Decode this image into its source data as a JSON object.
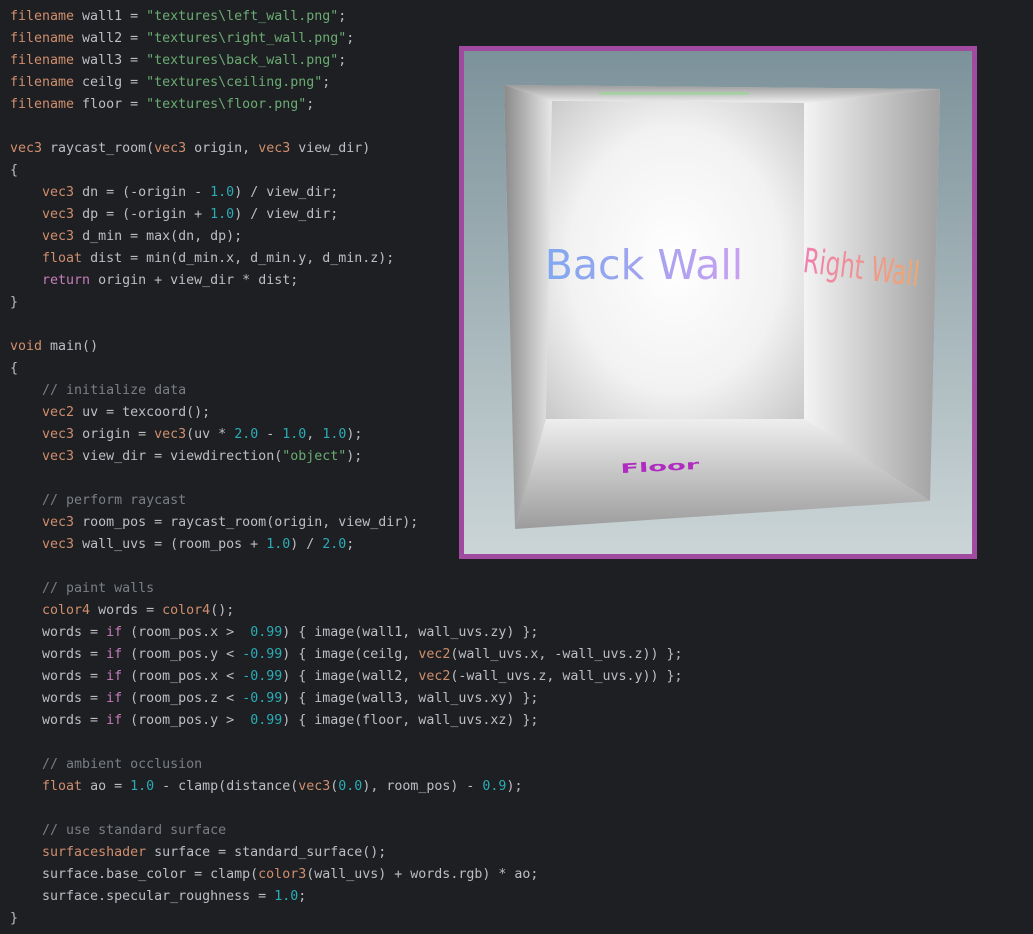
{
  "editor": {
    "lines": [
      [
        {
          "t": "filename",
          "c": "kw"
        },
        {
          "t": " wall1 = ",
          "c": "plain"
        },
        {
          "t": "\"textures\\left_wall.png\"",
          "c": "str"
        },
        {
          "t": ";",
          "c": "plain"
        }
      ],
      [
        {
          "t": "filename",
          "c": "kw"
        },
        {
          "t": " wall2 = ",
          "c": "plain"
        },
        {
          "t": "\"textures\\right_wall.png\"",
          "c": "str"
        },
        {
          "t": ";",
          "c": "plain"
        }
      ],
      [
        {
          "t": "filename",
          "c": "kw"
        },
        {
          "t": " wall3 = ",
          "c": "plain"
        },
        {
          "t": "\"textures\\back_wall.png\"",
          "c": "str"
        },
        {
          "t": ";",
          "c": "plain"
        }
      ],
      [
        {
          "t": "filename",
          "c": "kw"
        },
        {
          "t": " ceilg = ",
          "c": "plain"
        },
        {
          "t": "\"textures\\ceiling.png\"",
          "c": "str"
        },
        {
          "t": ";",
          "c": "plain"
        }
      ],
      [
        {
          "t": "filename",
          "c": "kw"
        },
        {
          "t": " floor = ",
          "c": "plain"
        },
        {
          "t": "\"textures\\floor.png\"",
          "c": "str"
        },
        {
          "t": ";",
          "c": "plain"
        }
      ],
      [],
      [
        {
          "t": "vec3",
          "c": "kw"
        },
        {
          "t": " raycast_room(",
          "c": "plain"
        },
        {
          "t": "vec3",
          "c": "kw"
        },
        {
          "t": " origin, ",
          "c": "plain"
        },
        {
          "t": "vec3",
          "c": "kw"
        },
        {
          "t": " view_dir)",
          "c": "plain"
        }
      ],
      [
        {
          "t": "{",
          "c": "plain"
        }
      ],
      [
        {
          "t": "    ",
          "c": "plain"
        },
        {
          "t": "vec3",
          "c": "kw"
        },
        {
          "t": " dn = (-origin - ",
          "c": "plain"
        },
        {
          "t": "1.0",
          "c": "num"
        },
        {
          "t": ") / view_dir;",
          "c": "plain"
        }
      ],
      [
        {
          "t": "    ",
          "c": "plain"
        },
        {
          "t": "vec3",
          "c": "kw"
        },
        {
          "t": " dp = (-origin + ",
          "c": "plain"
        },
        {
          "t": "1.0",
          "c": "num"
        },
        {
          "t": ") / view_dir;",
          "c": "plain"
        }
      ],
      [
        {
          "t": "    ",
          "c": "plain"
        },
        {
          "t": "vec3",
          "c": "kw"
        },
        {
          "t": " d_min = max(dn, dp);",
          "c": "plain"
        }
      ],
      [
        {
          "t": "    ",
          "c": "plain"
        },
        {
          "t": "float",
          "c": "kw"
        },
        {
          "t": " dist = min(d_min.x, d_min.y, d_min.z);",
          "c": "plain"
        }
      ],
      [
        {
          "t": "    ",
          "c": "plain"
        },
        {
          "t": "return",
          "c": "ctrl"
        },
        {
          "t": " origin + view_dir * dist;",
          "c": "plain"
        }
      ],
      [
        {
          "t": "}",
          "c": "plain"
        }
      ],
      [],
      [
        {
          "t": "void",
          "c": "kw"
        },
        {
          "t": " main()",
          "c": "plain"
        }
      ],
      [
        {
          "t": "{",
          "c": "plain"
        }
      ],
      [
        {
          "t": "    ",
          "c": "plain"
        },
        {
          "t": "// initialize data",
          "c": "cmt"
        }
      ],
      [
        {
          "t": "    ",
          "c": "plain"
        },
        {
          "t": "vec2",
          "c": "kw"
        },
        {
          "t": " uv = texcoord();",
          "c": "plain"
        }
      ],
      [
        {
          "t": "    ",
          "c": "plain"
        },
        {
          "t": "vec3",
          "c": "kw"
        },
        {
          "t": " origin = ",
          "c": "plain"
        },
        {
          "t": "vec3",
          "c": "kw"
        },
        {
          "t": "(uv * ",
          "c": "plain"
        },
        {
          "t": "2.0",
          "c": "num"
        },
        {
          "t": " - ",
          "c": "plain"
        },
        {
          "t": "1.0",
          "c": "num"
        },
        {
          "t": ", ",
          "c": "plain"
        },
        {
          "t": "1.0",
          "c": "num"
        },
        {
          "t": ");",
          "c": "plain"
        }
      ],
      [
        {
          "t": "    ",
          "c": "plain"
        },
        {
          "t": "vec3",
          "c": "kw"
        },
        {
          "t": " view_dir = viewdirection(",
          "c": "plain"
        },
        {
          "t": "\"object\"",
          "c": "str"
        },
        {
          "t": ");",
          "c": "plain"
        }
      ],
      [],
      [
        {
          "t": "    ",
          "c": "plain"
        },
        {
          "t": "// perform raycast",
          "c": "cmt"
        }
      ],
      [
        {
          "t": "    ",
          "c": "plain"
        },
        {
          "t": "vec3",
          "c": "kw"
        },
        {
          "t": " room_pos = raycast_room(origin, view_dir);",
          "c": "plain"
        }
      ],
      [
        {
          "t": "    ",
          "c": "plain"
        },
        {
          "t": "vec3",
          "c": "kw"
        },
        {
          "t": " wall_uvs = (room_pos + ",
          "c": "plain"
        },
        {
          "t": "1.0",
          "c": "num"
        },
        {
          "t": ") / ",
          "c": "plain"
        },
        {
          "t": "2.0",
          "c": "num"
        },
        {
          "t": ";",
          "c": "plain"
        }
      ],
      [],
      [
        {
          "t": "    ",
          "c": "plain"
        },
        {
          "t": "// paint walls",
          "c": "cmt"
        }
      ],
      [
        {
          "t": "    ",
          "c": "plain"
        },
        {
          "t": "color4",
          "c": "kw"
        },
        {
          "t": " words = ",
          "c": "plain"
        },
        {
          "t": "color4",
          "c": "kw"
        },
        {
          "t": "();",
          "c": "plain"
        }
      ],
      [
        {
          "t": "    words = ",
          "c": "plain"
        },
        {
          "t": "if",
          "c": "ctrl"
        },
        {
          "t": " (room_pos.x >  ",
          "c": "plain"
        },
        {
          "t": "0.99",
          "c": "num"
        },
        {
          "t": ") { image(wall1, wall_uvs.zy) };",
          "c": "plain"
        }
      ],
      [
        {
          "t": "    words = ",
          "c": "plain"
        },
        {
          "t": "if",
          "c": "ctrl"
        },
        {
          "t": " (room_pos.y < ",
          "c": "plain"
        },
        {
          "t": "-0.99",
          "c": "num"
        },
        {
          "t": ") { image(ceilg, ",
          "c": "plain"
        },
        {
          "t": "vec2",
          "c": "kw"
        },
        {
          "t": "(wall_uvs.x, -wall_uvs.z)) };",
          "c": "plain"
        }
      ],
      [
        {
          "t": "    words = ",
          "c": "plain"
        },
        {
          "t": "if",
          "c": "ctrl"
        },
        {
          "t": " (room_pos.x < ",
          "c": "plain"
        },
        {
          "t": "-0.99",
          "c": "num"
        },
        {
          "t": ") { image(wall2, ",
          "c": "plain"
        },
        {
          "t": "vec2",
          "c": "kw"
        },
        {
          "t": "(-wall_uvs.z, wall_uvs.y)) };",
          "c": "plain"
        }
      ],
      [
        {
          "t": "    words = ",
          "c": "plain"
        },
        {
          "t": "if",
          "c": "ctrl"
        },
        {
          "t": " (room_pos.z < ",
          "c": "plain"
        },
        {
          "t": "-0.99",
          "c": "num"
        },
        {
          "t": ") { image(wall3, wall_uvs.xy) };",
          "c": "plain"
        }
      ],
      [
        {
          "t": "    words = ",
          "c": "plain"
        },
        {
          "t": "if",
          "c": "ctrl"
        },
        {
          "t": " (room_pos.y >  ",
          "c": "plain"
        },
        {
          "t": "0.99",
          "c": "num"
        },
        {
          "t": ") { image(floor, wall_uvs.xz) };",
          "c": "plain"
        }
      ],
      [],
      [
        {
          "t": "    ",
          "c": "plain"
        },
        {
          "t": "// ambient occlusion",
          "c": "cmt"
        }
      ],
      [
        {
          "t": "    ",
          "c": "plain"
        },
        {
          "t": "float",
          "c": "kw"
        },
        {
          "t": " ao = ",
          "c": "plain"
        },
        {
          "t": "1.0",
          "c": "num"
        },
        {
          "t": " - clamp(distance(",
          "c": "plain"
        },
        {
          "t": "vec3",
          "c": "kw"
        },
        {
          "t": "(",
          "c": "plain"
        },
        {
          "t": "0.0",
          "c": "num"
        },
        {
          "t": "), room_pos) - ",
          "c": "plain"
        },
        {
          "t": "0.9",
          "c": "num"
        },
        {
          "t": ");",
          "c": "plain"
        }
      ],
      [],
      [
        {
          "t": "    ",
          "c": "plain"
        },
        {
          "t": "// use standard surface",
          "c": "cmt"
        }
      ],
      [
        {
          "t": "    ",
          "c": "plain"
        },
        {
          "t": "surfaceshader",
          "c": "kw"
        },
        {
          "t": " surface = standard_surface();",
          "c": "plain"
        }
      ],
      [
        {
          "t": "    surface.base_color = clamp(",
          "c": "plain"
        },
        {
          "t": "color3",
          "c": "kw"
        },
        {
          "t": "(wall_uvs) + words.rgb) * ao;",
          "c": "plain"
        }
      ],
      [
        {
          "t": "    surface.specular_roughness = ",
          "c": "plain"
        },
        {
          "t": "1.0",
          "c": "num"
        },
        {
          "t": ";",
          "c": "plain"
        }
      ],
      [
        {
          "t": "}",
          "c": "plain"
        }
      ]
    ]
  },
  "preview": {
    "border_color": "#a14ba0",
    "labels": {
      "back_wall": "Back Wall",
      "right_wall": "Right Wall",
      "floor": "Floor"
    }
  }
}
